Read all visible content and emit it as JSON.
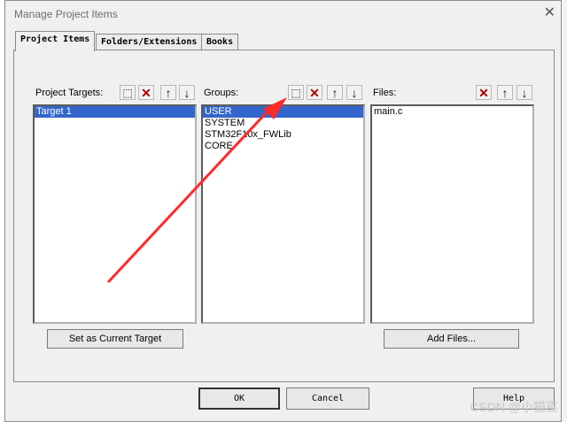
{
  "window": {
    "title": "Manage Project Items",
    "close_glyph": "✕"
  },
  "tabs": [
    {
      "label": "Project Items"
    },
    {
      "label": "Folders/Extensions"
    },
    {
      "label": "Books"
    }
  ],
  "project_targets": {
    "label": "Project Targets:",
    "items": [
      "Target 1"
    ],
    "selected_index": 0,
    "set_current_button": "Set as Current Target"
  },
  "groups": {
    "label": "Groups:",
    "items": [
      "USER",
      "SYSTEM",
      "STM32F10x_FWLib",
      "CORE"
    ],
    "selected_index": 0
  },
  "files": {
    "label": "Files:",
    "items": [
      "main.c"
    ],
    "add_files_button": "Add Files..."
  },
  "toolbar_icons": {
    "new": "new-item-icon",
    "delete": "delete-icon",
    "up": "move-up-icon",
    "down": "move-down-icon"
  },
  "buttons": {
    "ok": "OK",
    "cancel": "Cancel",
    "help": "Help"
  },
  "colors": {
    "selection": "#3366cc",
    "delete_icon": "#b00000",
    "annotation_arrow": "#ff2a2a"
  },
  "watermark": "CSDN @小猫巫"
}
